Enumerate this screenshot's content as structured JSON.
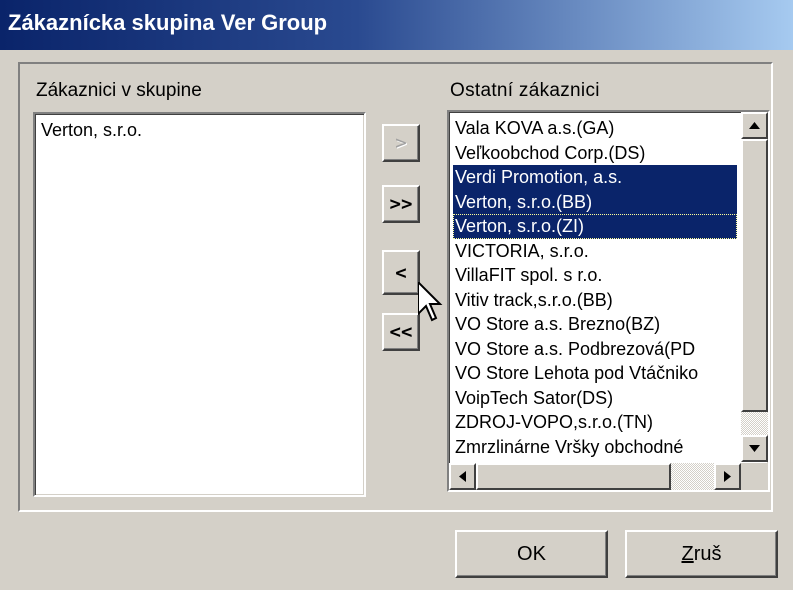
{
  "window": {
    "title": "Zákaznícka skupina Ver Group"
  },
  "left_panel": {
    "label": "Zákaznici v skupine",
    "items": [
      "Verton, s.r.o."
    ]
  },
  "right_panel": {
    "label": "Ostatní zákaznici",
    "items": [
      {
        "text": "Vala KOVA a.s.(GA)",
        "selected": false
      },
      {
        "text": "Veľkoobchod Corp.(DS)",
        "selected": false
      },
      {
        "text": "Verdi Promotion, a.s.",
        "selected": true
      },
      {
        "text": "Verton, s.r.o.(BB)",
        "selected": true
      },
      {
        "text": "Verton, s.r.o.(ZI)",
        "selected": true
      },
      {
        "text": "VICTORIA, s.r.o.",
        "selected": false
      },
      {
        "text": "VillaFIT spol. s r.o.",
        "selected": false
      },
      {
        "text": "Vitiv track,s.r.o.(BB)",
        "selected": false
      },
      {
        "text": "VO Store a.s. Brezno(BZ)",
        "selected": false
      },
      {
        "text": "VO Store a.s. Podbrezová(PD",
        "selected": false
      },
      {
        "text": "VO Store Lehota pod Vtáčniko",
        "selected": false
      },
      {
        "text": "VoipTech Sator(DS)",
        "selected": false
      },
      {
        "text": "ZDROJ-VOPO,s.r.o.(TN)",
        "selected": false
      },
      {
        "text": "Zmrzlinárne Vršky obchodné",
        "selected": false
      }
    ]
  },
  "transfer_buttons": {
    "add_one": ">",
    "add_all": ">>",
    "remove_one": "<",
    "remove_all": "<<"
  },
  "footer": {
    "ok_label": "OK",
    "cancel_label_prefix": "Z",
    "cancel_label_rest": "ruš"
  },
  "icons": {
    "scroll_up": "triangle-up-icon",
    "scroll_down": "triangle-down-icon",
    "scroll_left": "triangle-left-icon",
    "scroll_right": "triangle-right-icon",
    "cursor": "mouse-pointer-icon"
  },
  "colors": {
    "title_gradient_start": "#0a246a",
    "title_gradient_end": "#a6caf0",
    "selection": "#0a246a",
    "dialog_face": "#d4d0c8"
  }
}
